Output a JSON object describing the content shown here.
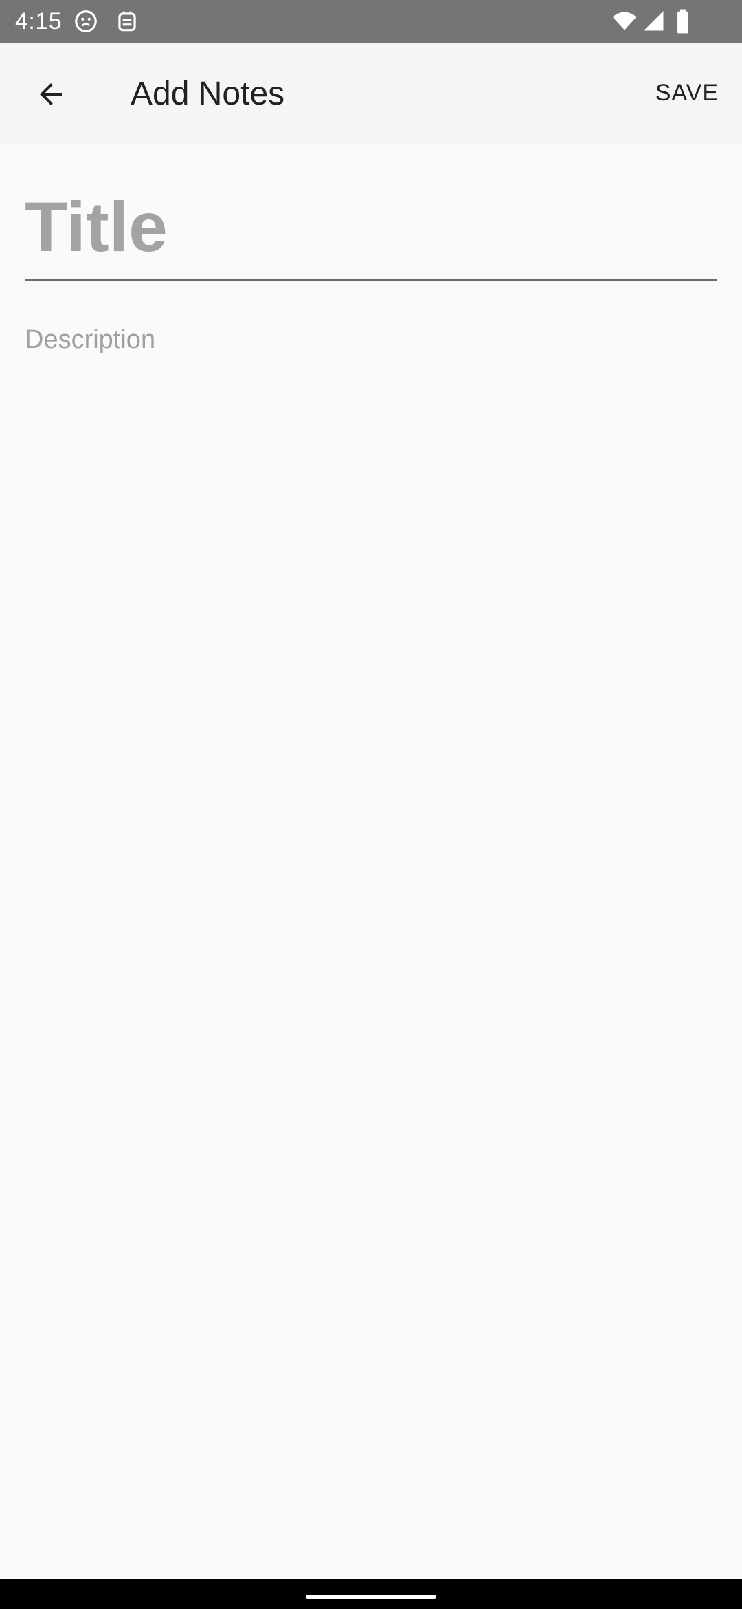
{
  "status_bar": {
    "time": "4:15",
    "icons": [
      "face-icon",
      "notification-app-icon",
      "wifi-icon",
      "cellular-signal-icon",
      "battery-icon"
    ]
  },
  "app_bar": {
    "title": "Add Notes",
    "back_icon": "arrow-back-icon",
    "save_label": "SAVE"
  },
  "form": {
    "title_placeholder": "Title",
    "title_value": "",
    "description_placeholder": "Description",
    "description_value": ""
  },
  "colors": {
    "status_bar": "#757575",
    "app_bar": "#f5f5f5",
    "background": "#fafafa",
    "placeholder": "#a3a3a3",
    "nav_bar": "#000000"
  }
}
